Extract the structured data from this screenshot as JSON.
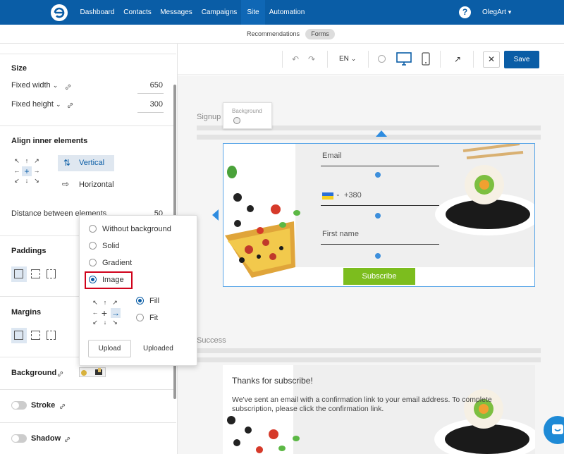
{
  "nav": {
    "items": [
      "Dashboard",
      "Contacts",
      "Messages",
      "Campaigns",
      "Site",
      "Automation"
    ],
    "active_index": 4,
    "help_label": "?",
    "user": "OlegArt"
  },
  "subnav": {
    "items": [
      "Recommendations",
      "Forms"
    ],
    "active": "Forms"
  },
  "left_panel": {
    "size": {
      "title": "Size",
      "width_label": "Fixed width",
      "width_value": "650",
      "height_label": "Fixed height",
      "height_value": "300"
    },
    "align": {
      "title": "Align inner elements",
      "vertical_label": "Vertical",
      "horizontal_label": "Horizontal"
    },
    "distance": {
      "label": "Distance between elements",
      "value": "50"
    },
    "paddings_title": "Paddings",
    "margins_title": "Margins",
    "background_title": "Background",
    "stroke_title": "Stroke",
    "shadow_title": "Shadow"
  },
  "background_popup": {
    "options": [
      "Without background",
      "Solid",
      "Gradient",
      "Image"
    ],
    "selected": "Image",
    "fit_options": [
      "Fill",
      "Fit"
    ],
    "fit_selected": "Fill",
    "upload_label": "Upload",
    "uploaded_label": "Uploaded"
  },
  "toolbar": {
    "language": "EN",
    "save_label": "Save"
  },
  "canvas": {
    "tooltip_label": "Background",
    "signup_label": "Signup",
    "success_label": "Success",
    "form": {
      "email_placeholder": "Email",
      "phone_code": "+380",
      "first_name_placeholder": "First name",
      "subscribe_label": "Subscribe"
    },
    "success": {
      "title": "Thanks for subscribe!",
      "message": "We've sent an email with a confirmation link to your email address. To complete subscription, please click the confirmation link."
    }
  },
  "colors": {
    "brand": "#0a5da6",
    "accent_green": "#7cbd1e",
    "highlight_red": "#d0021b"
  }
}
